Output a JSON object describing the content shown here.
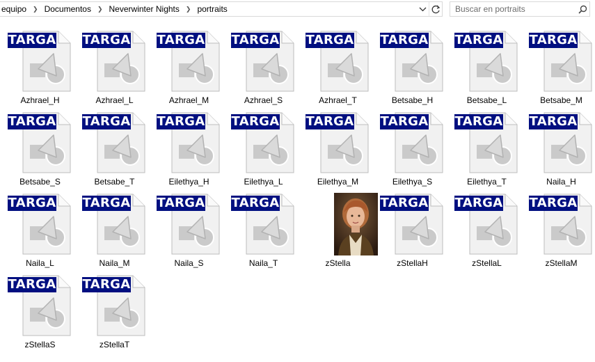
{
  "address_bar": {
    "crumbs": [
      "equipo",
      "Documentos",
      "Neverwinter Nights",
      "portraits"
    ],
    "dropdown_icon": "chevron-down-icon",
    "refresh_icon": "refresh-icon"
  },
  "search": {
    "placeholder": "Buscar en portraits",
    "icon": "search-icon"
  },
  "file_type_badge": "TARGA",
  "files": [
    {
      "name": "Azhrael_H",
      "type": "targa"
    },
    {
      "name": "Azhrael_L",
      "type": "targa"
    },
    {
      "name": "Azhrael_M",
      "type": "targa"
    },
    {
      "name": "Azhrael_S",
      "type": "targa"
    },
    {
      "name": "Azhrael_T",
      "type": "targa"
    },
    {
      "name": "Betsabe_H",
      "type": "targa"
    },
    {
      "name": "Betsabe_L",
      "type": "targa"
    },
    {
      "name": "Betsabe_M",
      "type": "targa"
    },
    {
      "name": "Betsabe_S",
      "type": "targa"
    },
    {
      "name": "Betsabe_T",
      "type": "targa"
    },
    {
      "name": "Eilethya_H",
      "type": "targa"
    },
    {
      "name": "Eilethya_L",
      "type": "targa"
    },
    {
      "name": "Eilethya_M",
      "type": "targa"
    },
    {
      "name": "Eilethya_S",
      "type": "targa"
    },
    {
      "name": "Eilethya_T",
      "type": "targa"
    },
    {
      "name": "Naila_H",
      "type": "targa"
    },
    {
      "name": "Naila_L",
      "type": "targa"
    },
    {
      "name": "Naila_M",
      "type": "targa"
    },
    {
      "name": "Naila_S",
      "type": "targa"
    },
    {
      "name": "Naila_T",
      "type": "targa"
    },
    {
      "name": "zStella",
      "type": "image"
    },
    {
      "name": "zStellaH",
      "type": "targa"
    },
    {
      "name": "zStellaL",
      "type": "targa"
    },
    {
      "name": "zStellaM",
      "type": "targa"
    },
    {
      "name": "zStellaS",
      "type": "targa"
    },
    {
      "name": "zStellaT",
      "type": "targa"
    }
  ]
}
